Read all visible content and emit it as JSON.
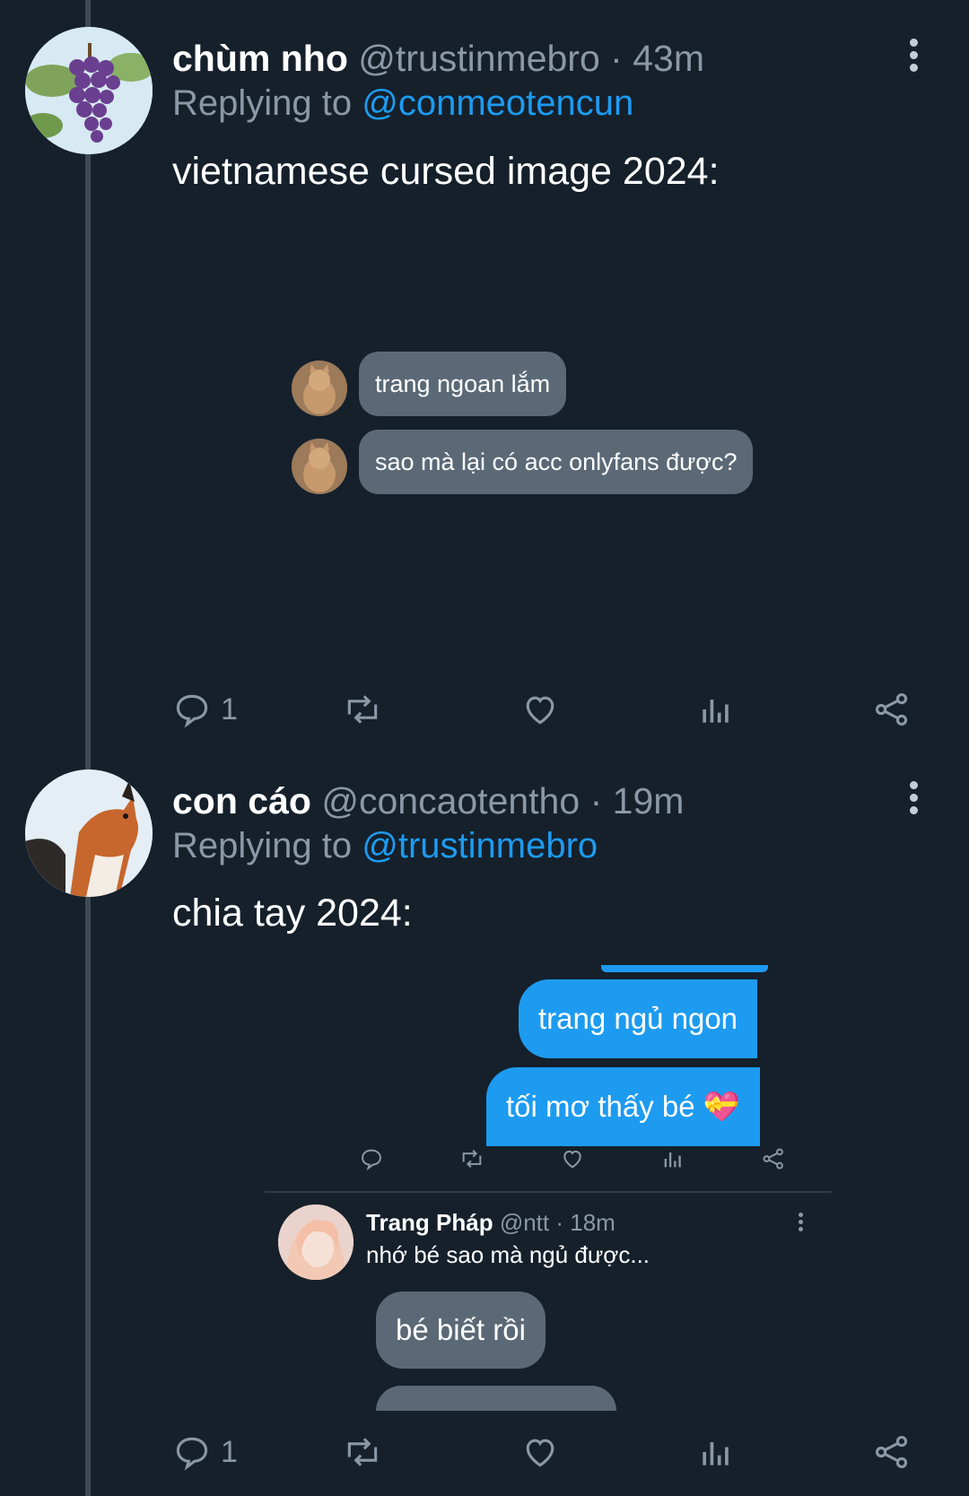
{
  "tweets": [
    {
      "name": "chùm nho",
      "handle": "@trustinmebro",
      "sep": "·",
      "time": "43m",
      "replying_prefix": "Replying to",
      "replying_to": "@conmeotencun",
      "text": "vietnamese cursed image 2024:",
      "embedded_chat": {
        "messages": [
          "trang ngoan lắm",
          "sao mà lại có acc onlyfans được?"
        ]
      },
      "actions": {
        "reply_count": "1"
      }
    },
    {
      "name": "con cáo",
      "handle": "@concaotentho",
      "sep": "·",
      "time": "19m",
      "replying_prefix": "Replying to",
      "replying_to": "@trustinmebro",
      "text": "chia tay 2024:",
      "embedded_chat": {
        "sent": [
          "trang ngủ ngon",
          "tối mơ thấy bé 💝"
        ],
        "nested_reply": {
          "name": "Trang Pháp",
          "handle": "@ntt",
          "sep": "·",
          "time": "18m",
          "text": "nhớ bé sao mà ngủ được..."
        },
        "received": [
          "bé biết rồi"
        ]
      },
      "actions": {
        "reply_count": "1"
      }
    }
  ],
  "colors": {
    "background": "#15202b",
    "accent": "#1d9bf0",
    "muted": "#8b98a5",
    "bubble_grey": "#5b6976"
  },
  "icons": [
    "reply-icon",
    "retweet-icon",
    "like-icon",
    "views-icon",
    "share-icon",
    "more-icon"
  ]
}
